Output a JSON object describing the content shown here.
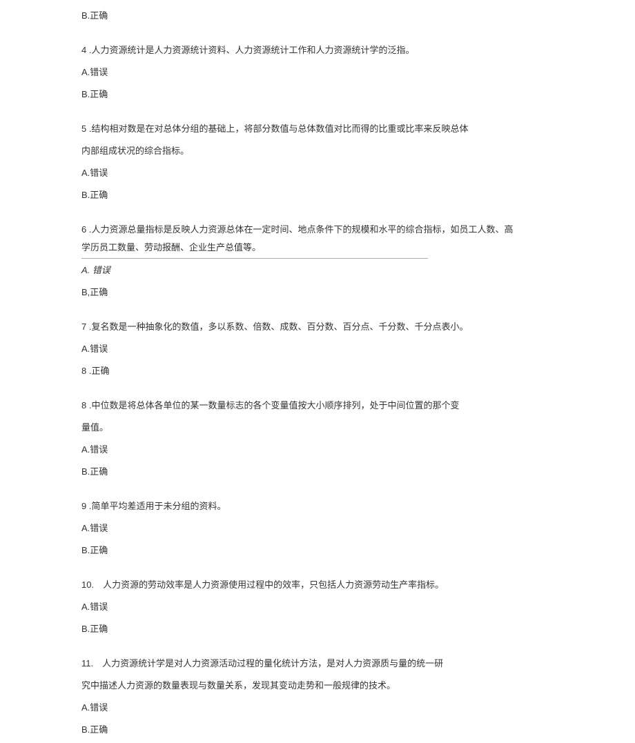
{
  "items": [
    {
      "type": "option",
      "text": "B.正确"
    },
    {
      "type": "spacer"
    },
    {
      "type": "question",
      "text": "4 .人力资源统计是人力资源统计资料、人力资源统计工作和人力资源统计学的泛指。"
    },
    {
      "type": "option",
      "text": "A.错误"
    },
    {
      "type": "option",
      "text": "B.正确"
    },
    {
      "type": "spacer"
    },
    {
      "type": "question",
      "text": "5 .结构相对数是在对总体分组的基础上，将部分数值与总体数值对比而得的比重或比率来反映总体"
    },
    {
      "type": "question",
      "text": "内部组成状况的综合指标。"
    },
    {
      "type": "option",
      "text": "A.错误"
    },
    {
      "type": "option",
      "text": "B.正确"
    },
    {
      "type": "spacer"
    },
    {
      "type": "q6",
      "line1": "6 .人力资源总量指标是反映人力资源总体在一定时间、地点条件下的规模和水平的综合指标，如员工人数、高",
      "line2": "学历员工数量、劳动报酬、企业生产总值等。"
    },
    {
      "type": "option-italic",
      "text": "A. 错误"
    },
    {
      "type": "option",
      "text": "B,正确"
    },
    {
      "type": "spacer"
    },
    {
      "type": "question",
      "text": "7 .复名数是一种抽象化的数值，多以系数、倍数、成数、百分数、百分点、千分数、千分点表小。"
    },
    {
      "type": "option",
      "text": "A.错误"
    },
    {
      "type": "option",
      "text": "8 .正确"
    },
    {
      "type": "spacer"
    },
    {
      "type": "question",
      "text": "8 .中位数是将总体各单位的某一数量标志的各个变量值按大小顺序排列，处于中间位置的那个变"
    },
    {
      "type": "question",
      "text": "量值。"
    },
    {
      "type": "option",
      "text": "A.错误"
    },
    {
      "type": "option",
      "text": "B.正确"
    },
    {
      "type": "spacer"
    },
    {
      "type": "question",
      "text": "9 .简单平均差适用于未分组的资料。"
    },
    {
      "type": "option",
      "text": "A.错误"
    },
    {
      "type": "option",
      "text": "B.正确"
    },
    {
      "type": "spacer"
    },
    {
      "type": "question",
      "text": "10. 人力资源的劳动效率是人力资源使用过程中的效率，只包括人力资源劳动生产率指标。"
    },
    {
      "type": "option",
      "text": "A.错误"
    },
    {
      "type": "option",
      "text": "B.正确"
    },
    {
      "type": "spacer"
    },
    {
      "type": "question",
      "text": "11. 人力资源统计学是对人力资源活动过程的量化统计方法，是对人力资源质与量的统一研"
    },
    {
      "type": "question",
      "text": "究中描述人力资源的数量表现与数量关系，发现其变动走势和一般规律的技术。"
    },
    {
      "type": "option",
      "text": "A.错误"
    },
    {
      "type": "option",
      "text": "B.正确"
    }
  ]
}
